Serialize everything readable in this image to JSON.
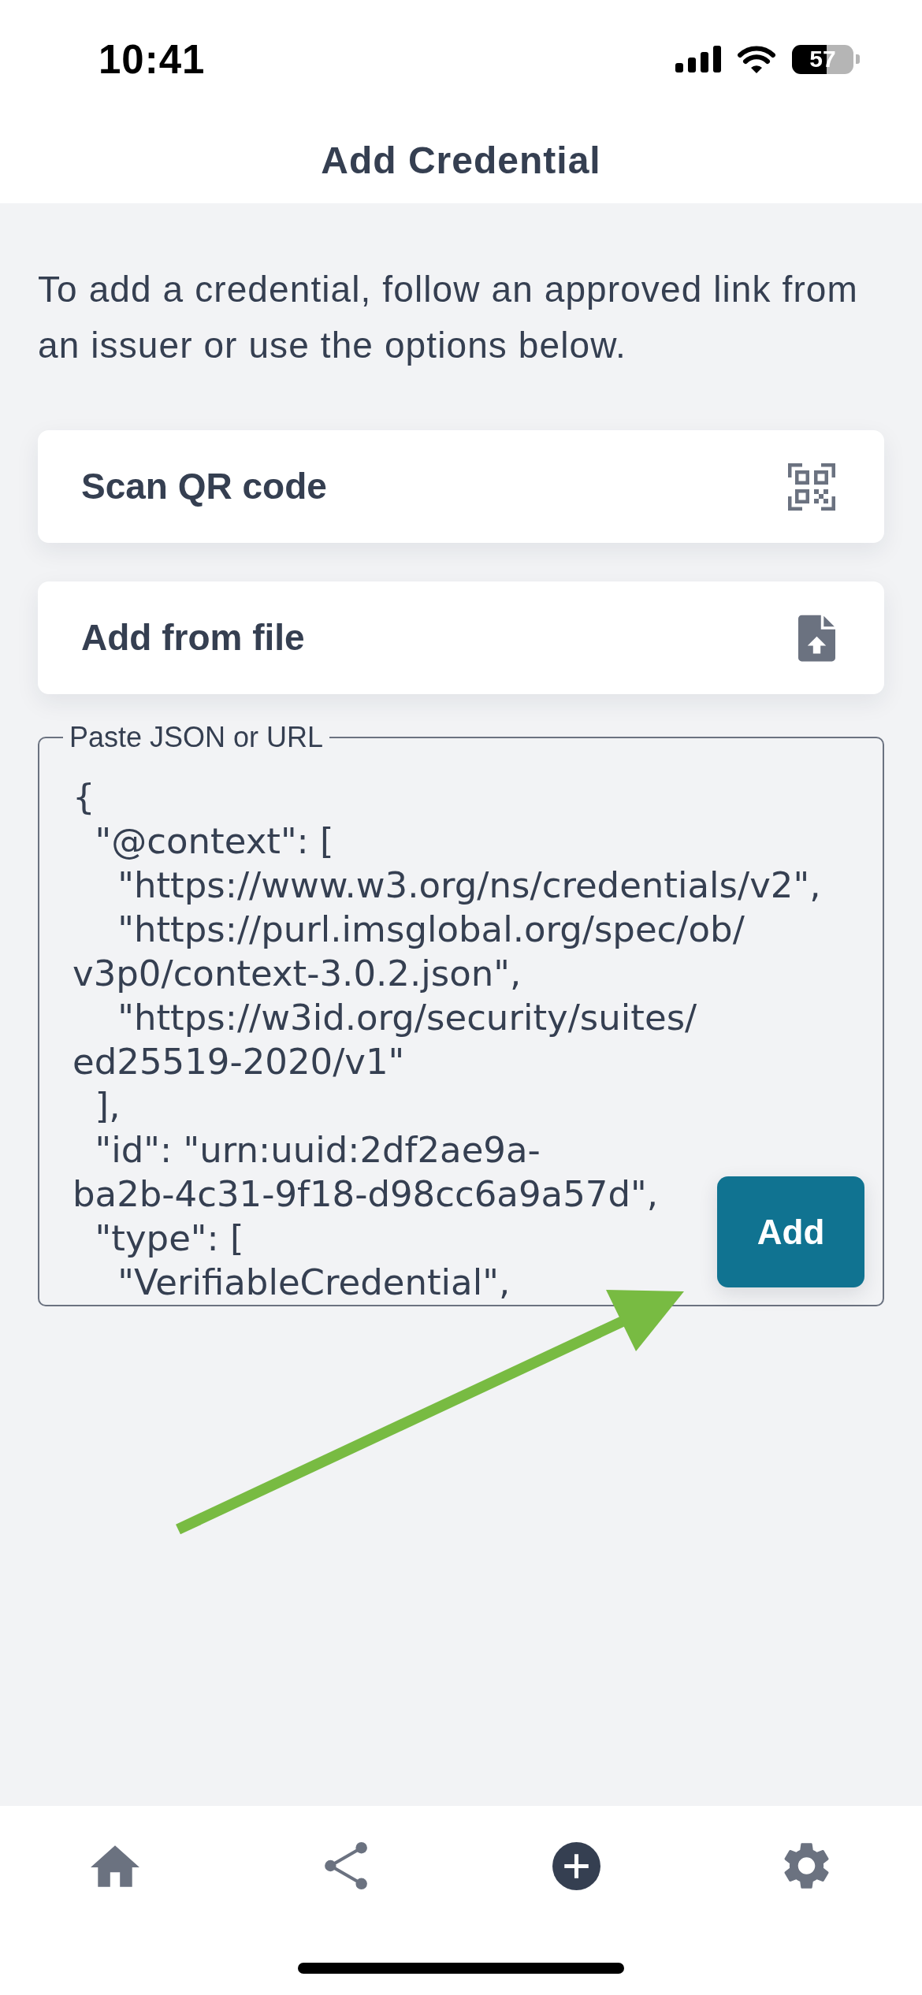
{
  "status_bar": {
    "time": "10:41",
    "battery": "57"
  },
  "header": {
    "title": "Add Credential"
  },
  "intro": "To add a credential, follow an approved link from an issuer or use the options below.",
  "options": [
    {
      "kind": "qr",
      "label": "Scan QR code"
    },
    {
      "kind": "file",
      "label": "Add from file"
    }
  ],
  "paste_field": {
    "label": "Paste JSON or URL",
    "value": "{\n  \"@context\": [\n    \"https://www.w3.org/ns/credentials/v2\",\n    \"https://purl.imsglobal.org/spec/ob/v3p0/context-3.0.2.json\",\n    \"https://w3id.org/security/suites/ed25519-2020/v1\"\n  ],\n  \"id\": \"urn:uuid:2df2ae9a-ba2b-4c31-9f18-d98cc6a9a57d\",\n  \"type\": [\n    \"VerifiableCredential\","
  },
  "add_button": {
    "label": "Add"
  },
  "tab_bar": {
    "items": [
      {
        "kind": "home",
        "selected": false
      },
      {
        "kind": "share",
        "selected": false
      },
      {
        "kind": "add",
        "selected": true
      },
      {
        "kind": "settings",
        "selected": false
      }
    ]
  }
}
